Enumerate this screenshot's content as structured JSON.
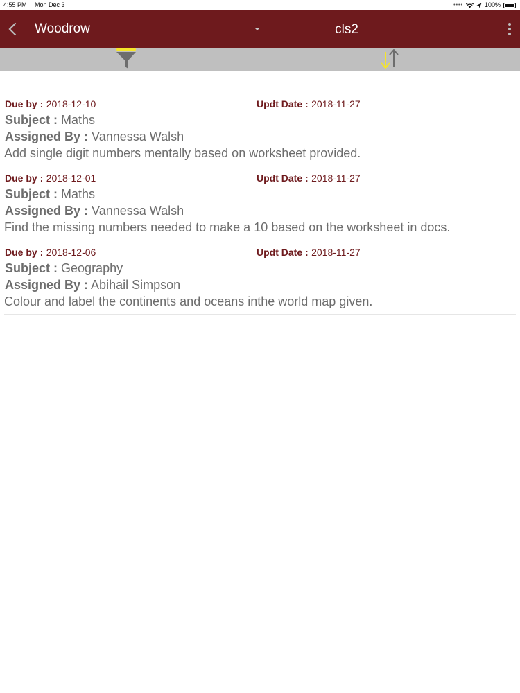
{
  "status_bar": {
    "time": "4:55 PM",
    "date": "Mon Dec 3",
    "battery": "100%"
  },
  "header": {
    "student": "Woodrow",
    "class": "cls2"
  },
  "icons": {
    "back": "chevron-left-icon",
    "dropdown": "caret-down-icon",
    "more": "more-vertical-icon",
    "filter": "filter-icon",
    "sort": "sort-icon"
  },
  "colors": {
    "header_bg": "#6e1a1d",
    "toolbar_bg": "#bfbfbf",
    "accent_yellow": "#f5e52a"
  },
  "labels": {
    "due_by": "Due by :",
    "updt_date": "Updt Date :",
    "subject": "Subject :",
    "assigned_by": "Assigned By :"
  },
  "assignments": [
    {
      "due": "2018-12-10",
      "updated": "2018-11-27",
      "subject": "Maths",
      "assigned_by": "Vannessa Walsh",
      "description": "Add single digit numbers mentally based on worksheet provided."
    },
    {
      "due": "2018-12-01",
      "updated": "2018-11-27",
      "subject": "Maths",
      "assigned_by": "Vannessa Walsh",
      "description": "Find the missing numbers needed to make a 10 based on the worksheet in docs."
    },
    {
      "due": "2018-12-06",
      "updated": "2018-11-27",
      "subject": "Geography",
      "assigned_by": "Abihail Simpson",
      "description": "Colour and label the continents and oceans inthe world map given."
    }
  ]
}
